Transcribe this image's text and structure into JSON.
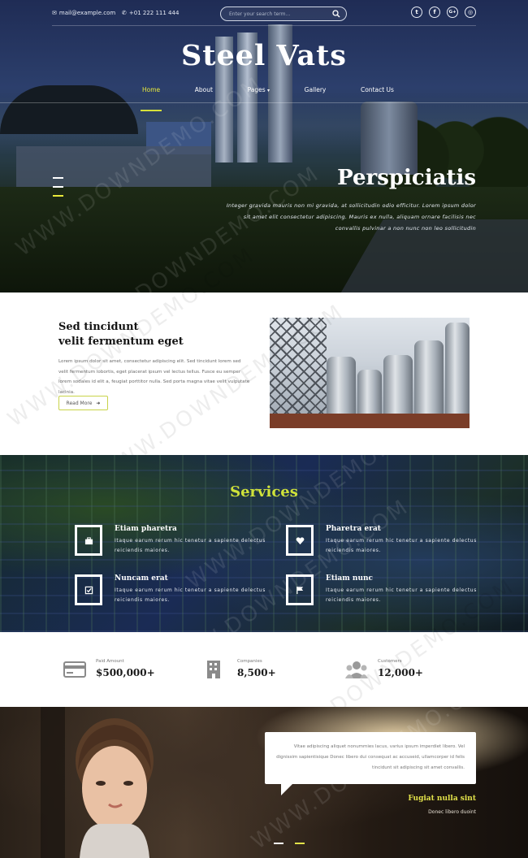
{
  "topbar": {
    "email": "mail@example.com",
    "phone": "+01 222 111 444",
    "search_placeholder": "Enter your search term...",
    "socials": [
      {
        "icon": "twitter-icon",
        "glyph": "t"
      },
      {
        "icon": "facebook-icon",
        "glyph": "f"
      },
      {
        "icon": "google-plus-icon",
        "glyph": "G+"
      },
      {
        "icon": "dribbble-icon",
        "glyph": "◎"
      }
    ]
  },
  "brand": "Steel Vats",
  "nav": {
    "items": [
      "Home",
      "About",
      "Pages",
      "Gallery",
      "Contact Us"
    ],
    "pages_caret": "▾",
    "active_color": "#e8e93a"
  },
  "hero": {
    "title": "Perspiciatis",
    "text": "Integer gravida mauris non mi gravida, at sollicitudin odio efficitur. Lorem ipsum dolor sit amet elit consectetur adipiscing. Mauris ex nulla, aliquam ornare facilisis nec convallis pulvinar a non nunc non leo sollicitudin"
  },
  "about": {
    "title_line1": "Sed tincidunt",
    "title_line2": "velit fermentum eget",
    "text": "Lorem ipsum dolor sit amet, consectetur adipiscing elit. Sed tincidunt lorem sed velit fermentum lobortis, eget placerat ipsum vel lectus tellus. Fusce eu semper lorem sodales id elit a, feugiat porttitor nulla. Sed porta magna vitae velit vulputate lacinia.",
    "button": "Read More",
    "button_arrow": "➜",
    "accent": "#c8d34a"
  },
  "services": {
    "title": "Services",
    "title_color": "#cfe23a",
    "items": [
      {
        "title": "Etiam pharetra",
        "text": "Itaque earum rerum hic tenetur a sapiente delectus reiciendis maiores.",
        "icon": "briefcase-icon"
      },
      {
        "title": "Pharetra erat",
        "text": "Itaque earum rerum hic tenetur a sapiente delectus reiciendis maiores.",
        "icon": "heart-icon"
      },
      {
        "title": "Nuncam erat",
        "text": "Itaque earum rerum hic tenetur a sapiente delectus reiciendis maiores.",
        "icon": "checklist-icon"
      },
      {
        "title": "Etiam nunc",
        "text": "Itaque earum rerum hic tenetur a sapiente delectus reiciendis maiores.",
        "icon": "flag-icon"
      }
    ]
  },
  "stats": [
    {
      "label": "Paid Amount",
      "value": "$500,000+",
      "icon": "credit-card-icon"
    },
    {
      "label": "Companies",
      "value": "8,500+",
      "icon": "building-icon"
    },
    {
      "label": "Customers",
      "value": "12,000+",
      "icon": "users-icon"
    }
  ],
  "testimonial": {
    "quote": "Vitae adipiscing aliquet nonummies lacus, varius ipsum imperdiet libero. Vel dignissim sapientisique Donec libero dui consequat ac accuseid, ullamcorper id felis tincidunt sit adipiscing sit amet convallis.",
    "name": "Fugiat nulla sint",
    "role": "Donec libero duoint",
    "accent": "#e2e24a"
  },
  "watermark": "WWW.DOWNDEMO.COM"
}
